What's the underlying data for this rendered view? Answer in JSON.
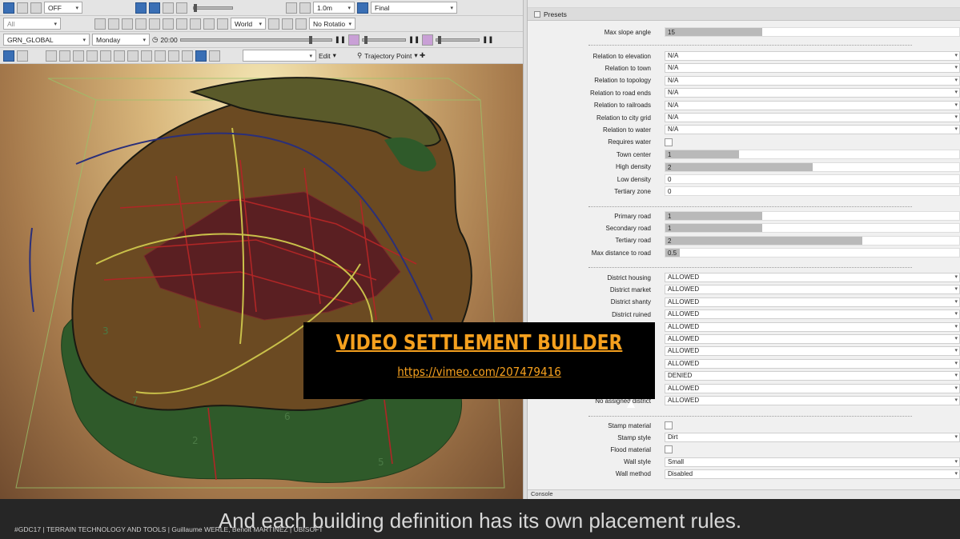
{
  "toolbar1": {
    "off_label": "OFF",
    "zoom_value": "1.0m",
    "quality_label": "Final"
  },
  "toolbar2": {
    "filter_label": "All",
    "space_label": "World",
    "rotation_label": "No Rotatio"
  },
  "toolbar3": {
    "layer_label": "GRN_GLOBAL",
    "day_label": "Monday",
    "time_label": "20:00"
  },
  "toolbar4": {
    "edit_label": "Edit",
    "trajectory_label": "Trajectory Point"
  },
  "viewport": {
    "district_numbers": [
      "7",
      "2",
      "6",
      "5",
      "3"
    ]
  },
  "panel": {
    "title": "Presets",
    "rows_a": [
      {
        "label": "Max slope angle",
        "value": "15",
        "fill": 0.33
      }
    ],
    "rows_b": [
      {
        "label": "Relation to elevation",
        "value": "N/A"
      },
      {
        "label": "Relation to town",
        "value": "N/A"
      },
      {
        "label": "Relation to topology",
        "value": "N/A"
      },
      {
        "label": "Relation to road ends",
        "value": "N/A"
      },
      {
        "label": "Relation to railroads",
        "value": "N/A"
      },
      {
        "label": "Relation to city grid",
        "value": "N/A"
      },
      {
        "label": "Relation to water",
        "value": "N/A"
      }
    ],
    "requires_water": {
      "label": "Requires water"
    },
    "rows_c": [
      {
        "label": "Town center",
        "value": "1",
        "fill": 0.25
      },
      {
        "label": "High density",
        "value": "2",
        "fill": 0.5
      },
      {
        "label": "Low density",
        "value": "0",
        "fill": 0
      },
      {
        "label": "Tertiary zone",
        "value": "0",
        "fill": 0
      }
    ],
    "rows_d": [
      {
        "label": "Primary road",
        "value": "1",
        "fill": 0.33
      },
      {
        "label": "Secondary road",
        "value": "1",
        "fill": 0.33
      },
      {
        "label": "Tertiary road",
        "value": "2",
        "fill": 0.67
      },
      {
        "label": "Max distance to road",
        "value": "0.5",
        "fill": 0.05
      }
    ],
    "rows_e": [
      {
        "label": "District housing",
        "value": "ALLOWED"
      },
      {
        "label": "District market",
        "value": "ALLOWED"
      },
      {
        "label": "District shanty",
        "value": "ALLOWED"
      },
      {
        "label": "District ruined",
        "value": "ALLOWED"
      },
      {
        "label": "",
        "value": "ALLOWED"
      },
      {
        "label": "",
        "value": "ALLOWED"
      },
      {
        "label": "",
        "value": "ALLOWED"
      },
      {
        "label": "",
        "value": "ALLOWED"
      },
      {
        "label": "",
        "value": "DENIED"
      },
      {
        "label": "",
        "value": "ALLOWED"
      },
      {
        "label": "No assigned district",
        "value": "ALLOWED"
      }
    ],
    "stamp_material": {
      "label": "Stamp material"
    },
    "stamp_style": {
      "label": "Stamp style",
      "value": "Dirt"
    },
    "flood_material": {
      "label": "Flood material"
    },
    "wall_style": {
      "label": "Wall style",
      "value": "Small"
    },
    "wall_method": {
      "label": "Wall method",
      "value": "Disabled"
    },
    "console_label": "Console"
  },
  "overlay": {
    "title": "VIDEO SETTLEMENT BUILDER",
    "url": "https://vimeo.com/207479416"
  },
  "caption": "And each building definition has its own placement rules.",
  "credit": "#GDC17 | TERRAIN TECHNOLOGY AND TOOLS | Guillaume WERLE, Benoit MARTINEZ | UBISOFT",
  "colors": {
    "overlay_text": "#f5a01e",
    "district_dark": "#5a1f22",
    "district_mid": "#6b4a22",
    "forest": "#2f5a2a",
    "road_red": "#b02626",
    "road_yellow": "#c9c04a",
    "river_blue": "#2a2f7a"
  }
}
